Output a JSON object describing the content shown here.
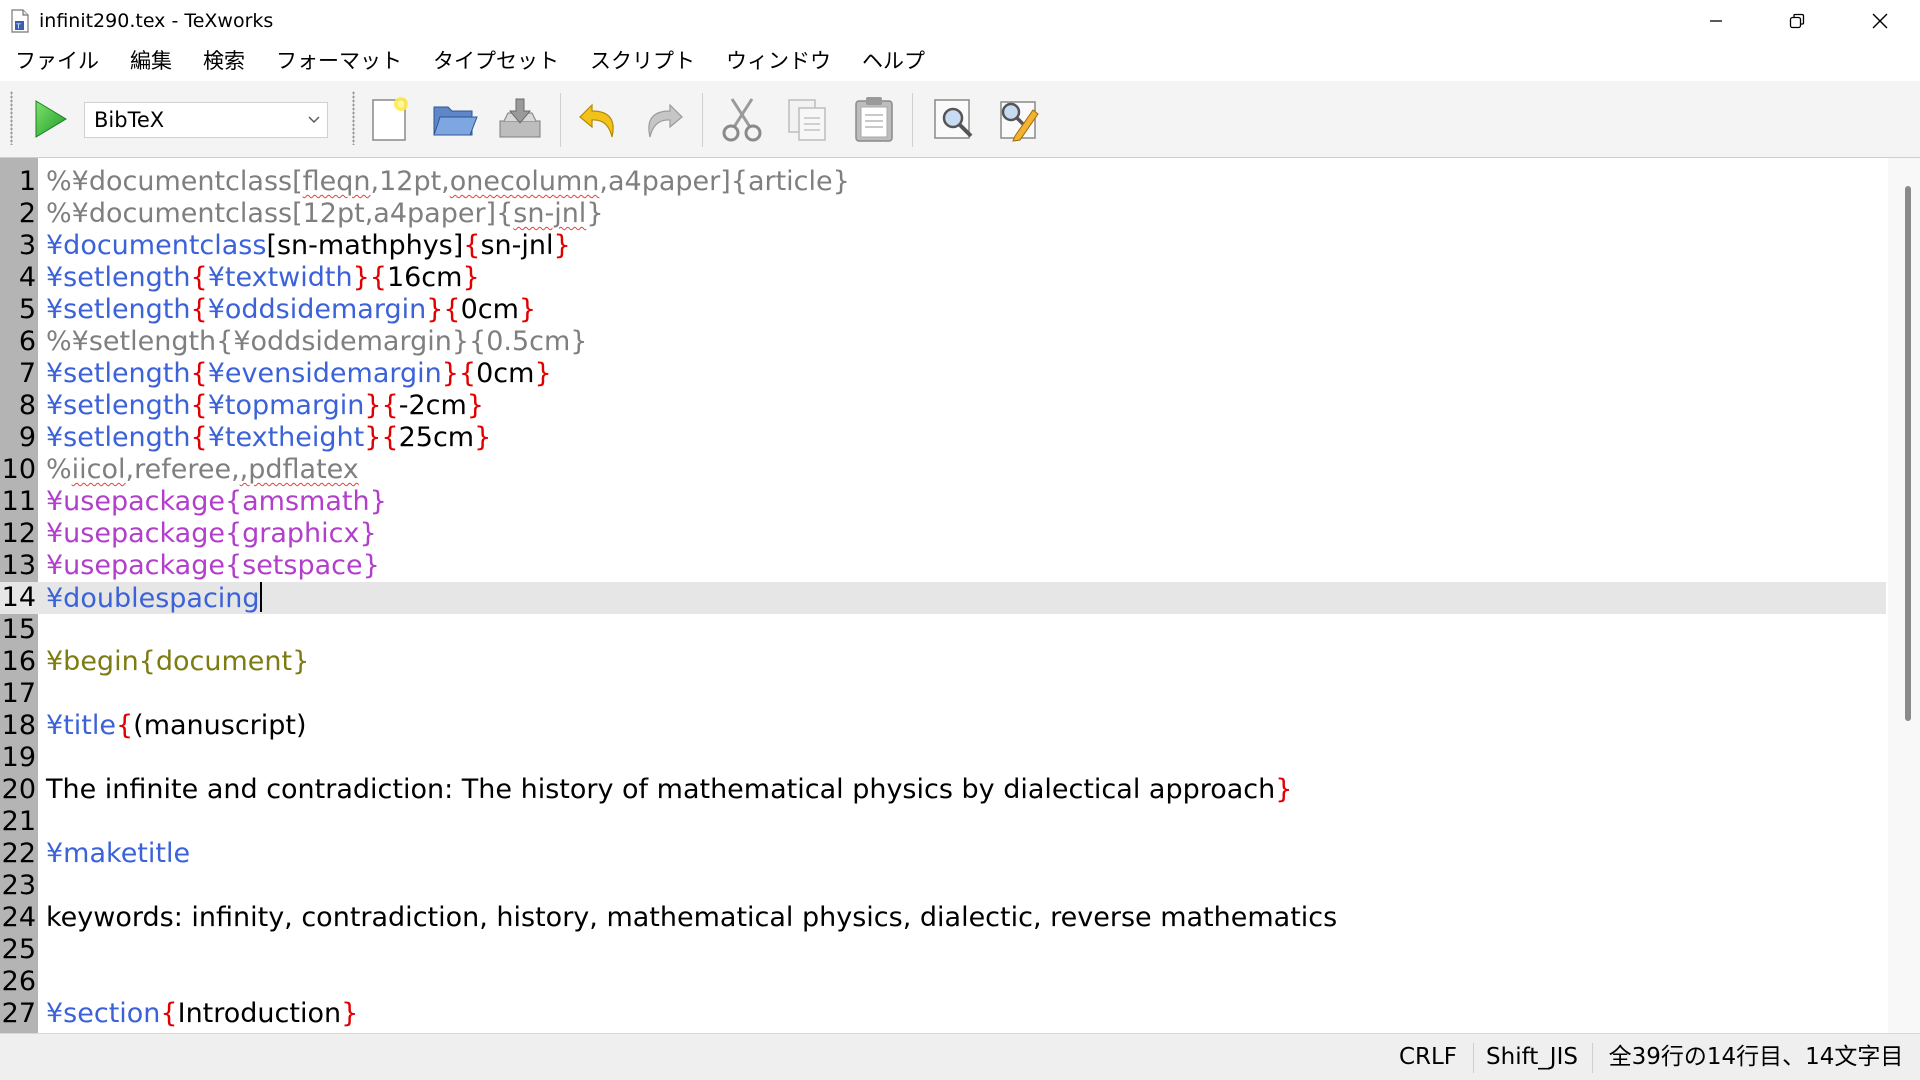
{
  "window": {
    "title": "infinit290.tex - TeXworks",
    "controls": [
      "minimize-icon",
      "restore-icon",
      "close-icon"
    ]
  },
  "menu": [
    "ファイル",
    "編集",
    "検索",
    "フォーマット",
    "タイプセット",
    "スクリプト",
    "ウィンドウ",
    "ヘルプ"
  ],
  "toolbar": {
    "engine": "BibTeX",
    "icons": [
      "typeset-play-icon",
      "new-document-icon",
      "open-folder-icon",
      "save-icon",
      "undo-icon",
      "redo-icon",
      "cut-icon",
      "copy-icon",
      "paste-icon",
      "find-icon",
      "replace-icon"
    ]
  },
  "editor": {
    "current_line": 14,
    "lines": [
      [
        [
          "cmt",
          "%¥documentclass["
        ],
        [
          "cmtS",
          "fleqn"
        ],
        [
          "cmt",
          ",12pt,"
        ],
        [
          "cmtS",
          "onecolumn"
        ],
        [
          "cmt",
          ",a4paper]{article}"
        ]
      ],
      [
        [
          "cmt",
          "%¥documentclass[12pt,a4paper]{"
        ],
        [
          "cmtS",
          "sn-jnl"
        ],
        [
          "cmt",
          "}"
        ]
      ],
      [
        [
          "cmd",
          "¥documentclass"
        ],
        [
          "txt",
          "[sn-mathphys]"
        ],
        [
          "br",
          "{"
        ],
        [
          "txt",
          "sn-jnl"
        ],
        [
          "br",
          "}"
        ]
      ],
      [
        [
          "cmd",
          "¥setlength"
        ],
        [
          "br",
          "{"
        ],
        [
          "cmd",
          "¥textwidth"
        ],
        [
          "br",
          "}{"
        ],
        [
          "txt",
          "16cm"
        ],
        [
          "br",
          "}"
        ]
      ],
      [
        [
          "cmd",
          "¥setlength"
        ],
        [
          "br",
          "{"
        ],
        [
          "cmd",
          "¥oddsidemargin"
        ],
        [
          "br",
          "}{"
        ],
        [
          "txt",
          "0cm"
        ],
        [
          "br",
          "}"
        ]
      ],
      [
        [
          "cmt",
          "%¥setlength{¥oddsidemargin}{0.5cm}"
        ]
      ],
      [
        [
          "cmd",
          "¥setlength"
        ],
        [
          "br",
          "{"
        ],
        [
          "cmd",
          "¥evensidemargin"
        ],
        [
          "br",
          "}{"
        ],
        [
          "txt",
          "0cm"
        ],
        [
          "br",
          "}"
        ]
      ],
      [
        [
          "cmd",
          "¥setlength"
        ],
        [
          "br",
          "{"
        ],
        [
          "cmd",
          "¥topmargin"
        ],
        [
          "br",
          "}{"
        ],
        [
          "txt",
          "-2cm"
        ],
        [
          "br",
          "}"
        ]
      ],
      [
        [
          "cmd",
          "¥setlength"
        ],
        [
          "br",
          "{"
        ],
        [
          "cmd",
          "¥textheight"
        ],
        [
          "br",
          "}{"
        ],
        [
          "txt",
          "25cm"
        ],
        [
          "br",
          "}"
        ]
      ],
      [
        [
          "cmt",
          "%"
        ],
        [
          "cmtS",
          "iicol"
        ],
        [
          "cmt",
          ",referee,"
        ],
        [
          "cmtS",
          ",pdflatex"
        ]
      ],
      [
        [
          "pkg",
          "¥usepackage{amsmath}"
        ]
      ],
      [
        [
          "pkg",
          "¥usepackage{graphicx}"
        ]
      ],
      [
        [
          "pkg",
          "¥usepackage{setspace}"
        ]
      ],
      [
        [
          "cmd",
          "¥doublespacing"
        ]
      ],
      [],
      [
        [
          "env",
          "¥begin{document}"
        ]
      ],
      [],
      [
        [
          "cmd",
          "¥title"
        ],
        [
          "br",
          "{"
        ],
        [
          "txt",
          "(manuscript)"
        ]
      ],
      [],
      [
        [
          "txt",
          "The infinite and contradiction: The history of mathematical physics by dialectical approach"
        ],
        [
          "br",
          "}"
        ]
      ],
      [],
      [
        [
          "cmd",
          "¥maketitle"
        ]
      ],
      [],
      [
        [
          "txt",
          "keywords: infinity, contradiction, history, mathematical physics, dialectic, reverse mathematics"
        ]
      ],
      [],
      [],
      [
        [
          "cmd",
          "¥section"
        ],
        [
          "br",
          "{"
        ],
        [
          "txt",
          "Introduction"
        ],
        [
          "br",
          "}"
        ]
      ]
    ]
  },
  "status": {
    "line_ending": "CRLF",
    "encoding": "Shift_JIS",
    "position": "全39行の14行目、14文字目"
  }
}
